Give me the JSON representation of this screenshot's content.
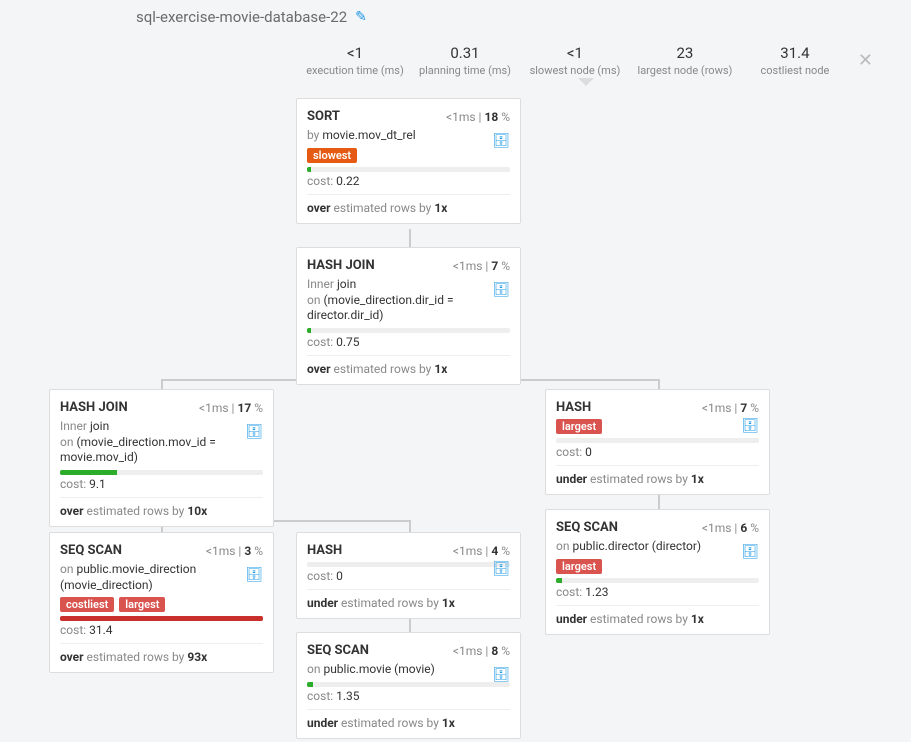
{
  "header": {
    "title": "sql-exercise-movie-database-22"
  },
  "stats": {
    "exec_time": {
      "value": "<1",
      "label": "execution time (ms)"
    },
    "plan_time": {
      "value": "0.31",
      "label": "planning time (ms)"
    },
    "slowest_node": {
      "value": "<1",
      "label": "slowest node (ms)"
    },
    "largest_node": {
      "value": "23",
      "label": "largest node (rows)"
    },
    "costliest_node": {
      "value": "31.4",
      "label": "costliest node"
    }
  },
  "nodes": {
    "sort": {
      "title": "SORT",
      "time": "<1ms",
      "pct": "18",
      "sub_prefix": "by ",
      "sub_value": "movie.mov_dt_rel",
      "tags": [
        "slowest"
      ],
      "bar_w": "2%",
      "bar_color": "green",
      "cost": "0.22",
      "est_dir": "over",
      "est_mid": " estimated rows by ",
      "est_x": "1x"
    },
    "hashjoin1": {
      "title": "HASH JOIN",
      "time": "<1ms",
      "pct": "7",
      "sub_html": "Inner <span>join</span><br>on <span>(movie_direction.dir_id = director.dir_id)</span>",
      "bar_w": "2%",
      "bar_color": "green",
      "cost": "0.75",
      "est_dir": "over",
      "est_mid": " estimated rows by ",
      "est_x": "1x"
    },
    "hashjoin2": {
      "title": "HASH JOIN",
      "time": "<1ms",
      "pct": "17",
      "sub_html": "Inner <span>join</span><br>on <span>(movie_direction.mov_id = movie.mov_id)</span>",
      "bar_w": "28%",
      "bar_color": "green",
      "cost": "9.1",
      "est_dir": "over",
      "est_mid": " estimated rows by ",
      "est_x": "10x"
    },
    "seqscan_movdir": {
      "title": "SEQ SCAN",
      "time": "<1ms",
      "pct": "3",
      "sub_prefix": "on ",
      "sub_value": "public.movie_direction (movie_direction)",
      "tags": [
        "costliest",
        "largest"
      ],
      "bar_w": "100%",
      "bar_color": "red",
      "cost": "31.4",
      "est_dir": "over",
      "est_mid": " estimated rows by ",
      "est_x": "93x"
    },
    "hash_left": {
      "title": "HASH",
      "time": "<1ms",
      "pct": "4",
      "bar_w": "0%",
      "bar_color": "green",
      "cost": "0",
      "est_dir": "under",
      "est_mid": " estimated rows by ",
      "est_x": "1x"
    },
    "seqscan_movie": {
      "title": "SEQ SCAN",
      "time": "<1ms",
      "pct": "8",
      "sub_prefix": "on ",
      "sub_value": "public.movie (movie)",
      "bar_w": "3%",
      "bar_color": "green",
      "cost": "1.35",
      "est_dir": "under",
      "est_mid": " estimated rows by ",
      "est_x": "1x"
    },
    "hash_right": {
      "title": "HASH",
      "time": "<1ms",
      "pct": "7",
      "tags": [
        "largest"
      ],
      "bar_w": "0%",
      "bar_color": "green",
      "cost": "0",
      "est_dir": "under",
      "est_mid": " estimated rows by ",
      "est_x": "1x"
    },
    "seqscan_director": {
      "title": "SEQ SCAN",
      "time": "<1ms",
      "pct": "6",
      "sub_prefix": "on ",
      "sub_value": "public.director (director)",
      "tags": [
        "largest"
      ],
      "bar_w": "3%",
      "bar_color": "green",
      "cost": "1.23",
      "est_dir": "under",
      "est_mid": " estimated rows by ",
      "est_x": "1x"
    }
  },
  "labels": {
    "cost_prefix": "cost: "
  }
}
